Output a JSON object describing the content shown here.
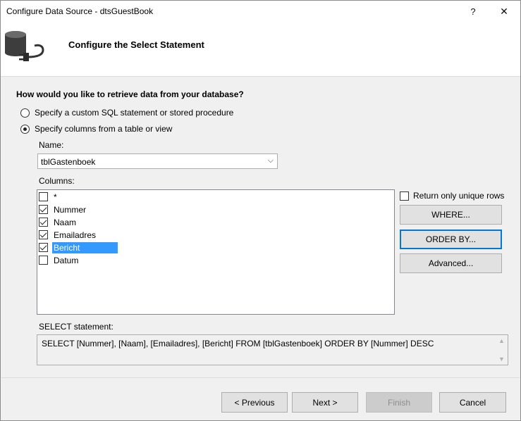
{
  "window": {
    "title": "Configure Data Source - dtsGuestBook",
    "help_glyph": "?",
    "close_glyph": "✕"
  },
  "header": {
    "title": "Configure the Select Statement",
    "icon": "database-plug-icon"
  },
  "question": "How would you like to retrieve data from your database?",
  "options": {
    "custom_sql": "Specify a custom SQL statement or stored procedure",
    "table_view": "Specify columns from a table or view",
    "selected": "table_view"
  },
  "name_field": {
    "label": "Name:",
    "value": "tblGastenboek",
    "arrow": "⌵"
  },
  "columns": {
    "label": "Columns:",
    "items": [
      {
        "label": "*",
        "checked": false,
        "selected": false
      },
      {
        "label": "Nummer",
        "checked": true,
        "selected": false
      },
      {
        "label": "Naam",
        "checked": true,
        "selected": false
      },
      {
        "label": "Emailadres",
        "checked": true,
        "selected": false
      },
      {
        "label": "Bericht",
        "checked": true,
        "selected": true
      },
      {
        "label": "Datum",
        "checked": false,
        "selected": false
      }
    ]
  },
  "unique_rows": {
    "label": "Return only unique rows",
    "checked": false
  },
  "side_buttons": {
    "where": "WHERE...",
    "order_by": "ORDER BY...",
    "advanced": "Advanced..."
  },
  "select_statement": {
    "label": "SELECT statement:",
    "value": "SELECT [Nummer], [Naam], [Emailadres], [Bericht] FROM [tblGastenboek] ORDER BY [Nummer] DESC",
    "scroll_up": "▲",
    "scroll_down": "▼"
  },
  "footer": {
    "previous": "< Previous",
    "next": "Next >",
    "finish": "Finish",
    "cancel": "Cancel"
  },
  "colors": {
    "selection": "#3399ff",
    "focus_border": "#0078d7",
    "dialog_bg": "#f0f0f0"
  }
}
